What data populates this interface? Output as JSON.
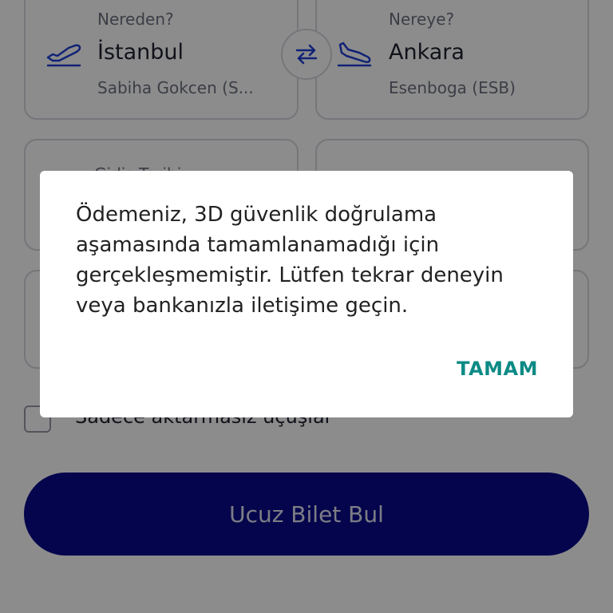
{
  "form": {
    "from": {
      "label": "Nereden?",
      "city": "İstanbul",
      "airport": "Sabiha Gokcen (S..."
    },
    "to": {
      "label": "Nereye?",
      "city": "Ankara",
      "airport": "Esenboga (ESB)"
    },
    "departure_label": "Gidiş Tarihi",
    "direct_only_label": "Sadece aktarmasız uçuşlar",
    "search_button": "Ucuz Bilet Bul"
  },
  "dialog": {
    "message": "Ödemeniz, 3D güvenlik doğrulama aşamasında tamamlanamadığı için gerçekleşmemiştir. Lütfen tekrar deneyin veya bankanızla iletişime geçin.",
    "ok_label": "TAMAM"
  },
  "colors": {
    "primary_button": "#0a0a8c",
    "dialog_action": "#0c8a85",
    "icon_blue": "#1f3fd6"
  },
  "icons": {
    "departure": "plane-departure-icon",
    "arrival": "plane-arrival-icon",
    "swap": "swap-arrows-icon"
  }
}
